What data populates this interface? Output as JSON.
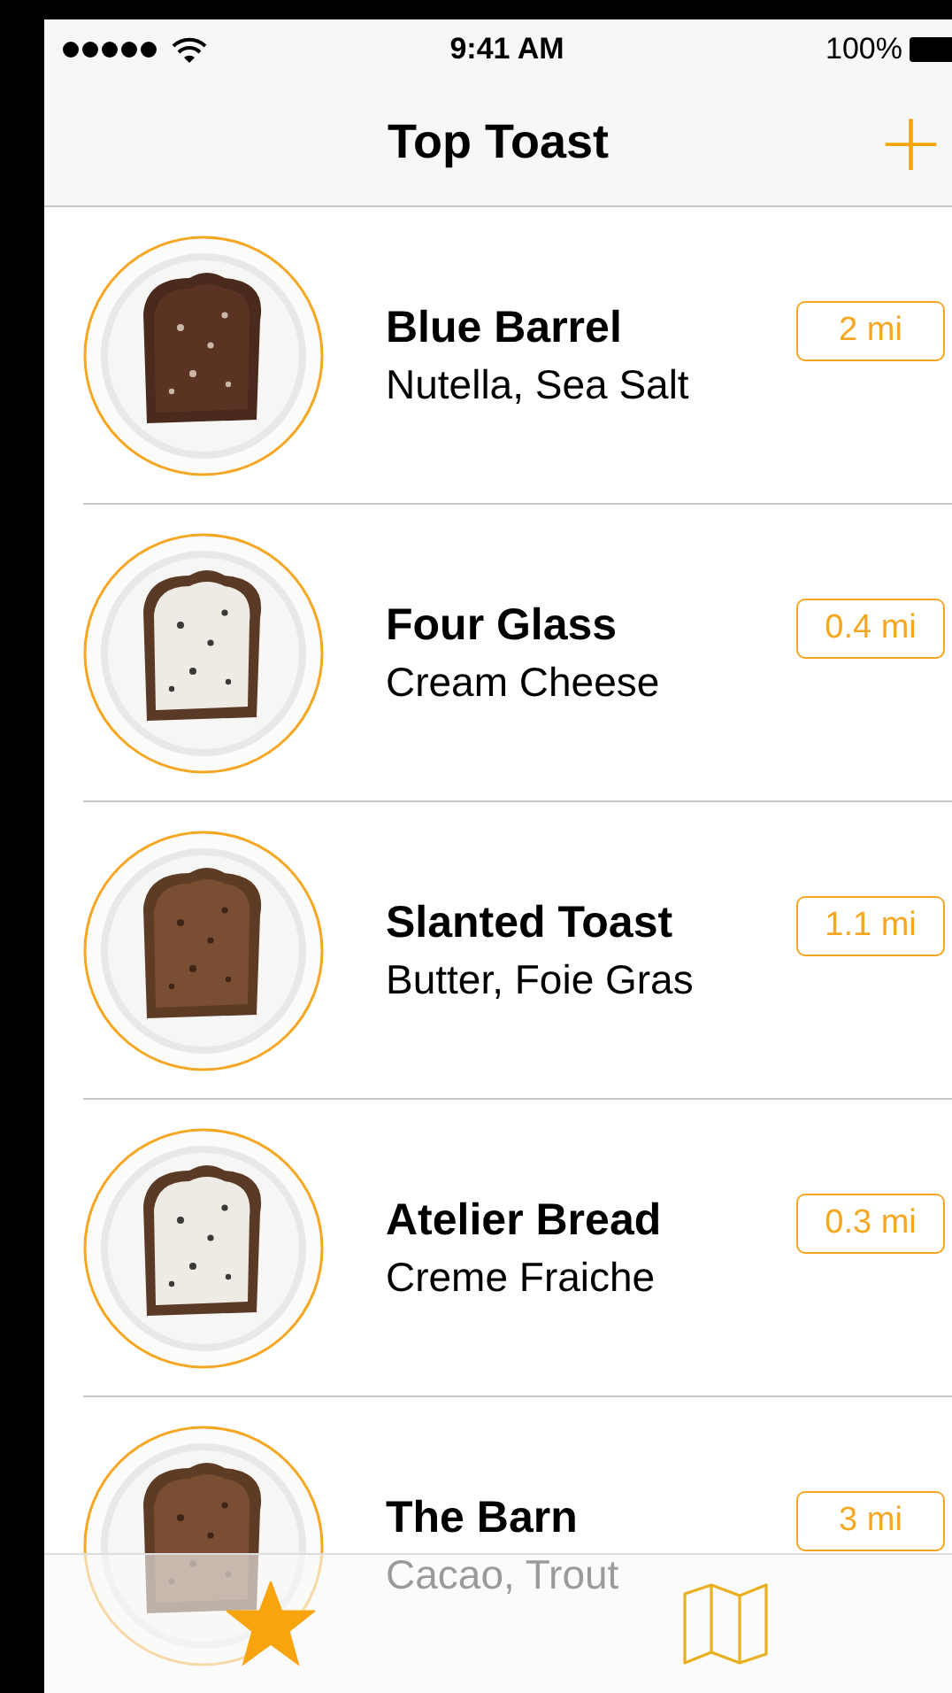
{
  "status_bar": {
    "time": "9:41 AM",
    "battery": "100%"
  },
  "nav": {
    "title": "Top Toast",
    "add": "+"
  },
  "places": [
    {
      "name": "Blue Barrel",
      "toppings": "Nutella, Sea Salt",
      "distance": "2 mi"
    },
    {
      "name": "Four Glass",
      "toppings": "Cream Cheese",
      "distance": "0.4 mi"
    },
    {
      "name": "Slanted Toast",
      "toppings": "Butter, Foie Gras",
      "distance": "1.1 mi"
    },
    {
      "name": "Atelier Bread",
      "toppings": "Creme Fraiche",
      "distance": "0.3 mi"
    },
    {
      "name": "The Barn",
      "toppings": "Cacao, Trout",
      "distance": "3 mi"
    }
  ],
  "tab_bar": {
    "tabs": [
      {
        "kind": "star",
        "selected": true
      },
      {
        "kind": "map",
        "selected": false
      }
    ]
  }
}
